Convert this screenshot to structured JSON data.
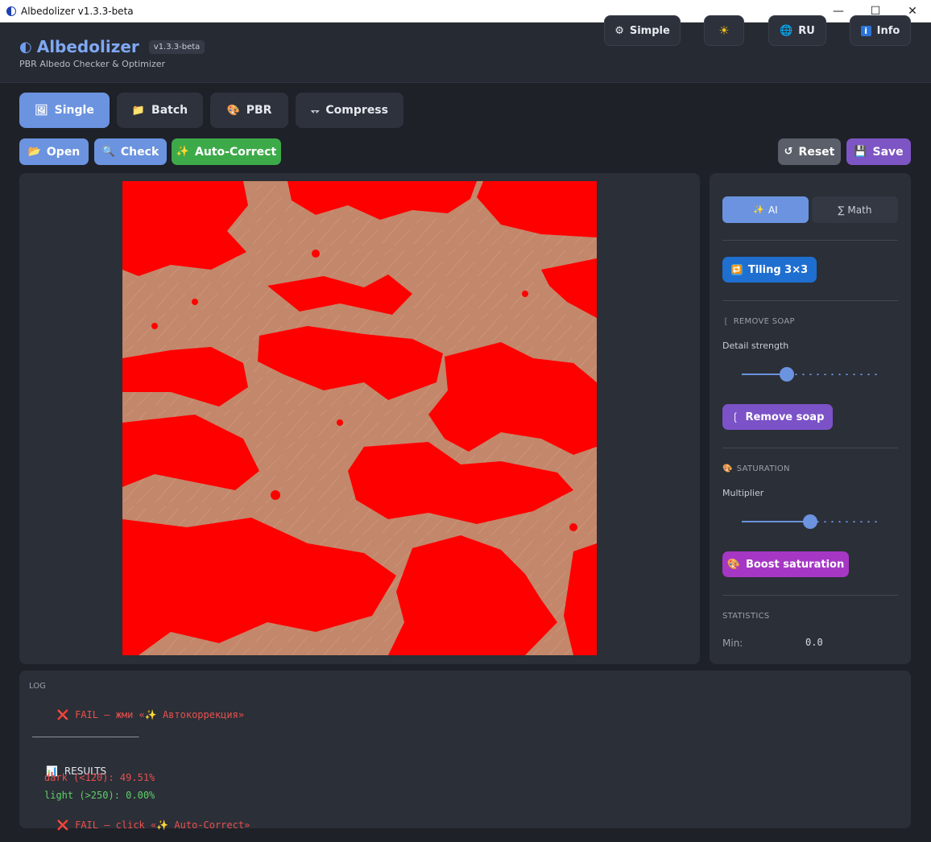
{
  "window": {
    "title": "Albedolizer v1.3.3-beta"
  },
  "header": {
    "name": "Albedolizer",
    "version": "v1.3.3-beta",
    "subtitle": "PBR Albedo Checker & Optimizer",
    "buttons": {
      "simple": "Simple",
      "lang": "RU",
      "info": "Info"
    }
  },
  "tabs": [
    {
      "label": "Single",
      "icon": "image-icon"
    },
    {
      "label": "Batch",
      "icon": "folder-icon"
    },
    {
      "label": "PBR",
      "icon": "palette-icon"
    },
    {
      "label": "Compress",
      "icon": "compress-icon"
    }
  ],
  "actions": {
    "open": "Open",
    "check": "Check",
    "auto": "Auto-Correct",
    "reset": "Reset",
    "save": "Save"
  },
  "side": {
    "mode_ai": "AI",
    "mode_math": "∑ Math",
    "tiling": "Tiling 3×3",
    "soap_title": "REMOVE SOAP",
    "detail_label": "Detail strength",
    "detail_value": 0.33,
    "soap_button": "Remove soap",
    "sat_title": "SATURATION",
    "mult_label": "Multiplier",
    "mult_value": 0.5,
    "sat_button": "Boost saturation",
    "stats_title": "STATISTICS",
    "min_label": "Min:",
    "min_value": "0.0"
  },
  "log": {
    "title": "LOG",
    "line1": "FAIL — жми «✨ Автокоррекция»",
    "separator": "──────────────────────",
    "results": "RESULTS",
    "dark": "dark (<120): 49.51%",
    "light": "light (>250): 0.00%",
    "line_fail": "FAIL — click «✨ Auto-Correct»"
  },
  "colors": {
    "accent": "#6b93df",
    "autocorrect": "#3daa4a",
    "save": "#7e55c4",
    "tiling": "#1f6fd0",
    "soap": "#7b52c7",
    "saturation": "#a637c4",
    "fail": "#e8504f"
  }
}
